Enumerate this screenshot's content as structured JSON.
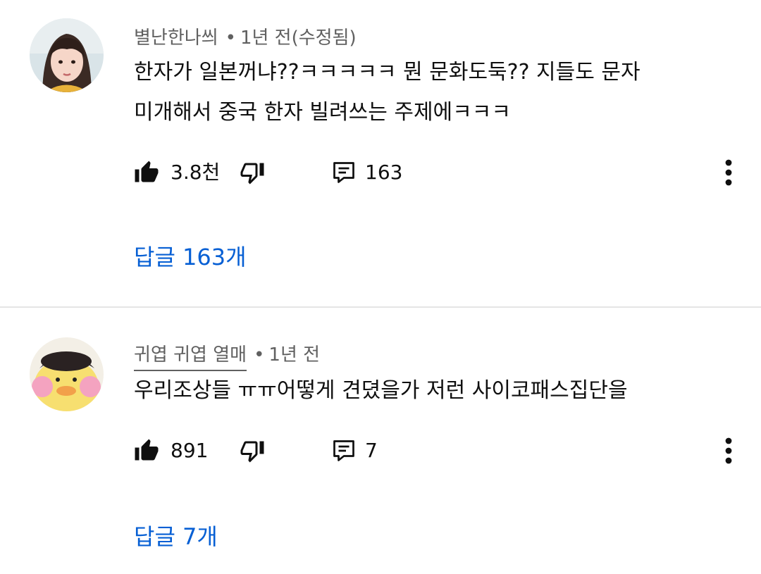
{
  "comments": [
    {
      "author": "별난한나씌",
      "time": "1년 전(수정됨)",
      "text_line1": "한자가 일본꺼냐??ㅋㅋㅋㅋㅋ 뭔 문화도둑?? 지들도 문자",
      "text_line2": "미개해서 중국 한자 빌려쓰는 주제에ㅋㅋㅋ",
      "likes": "3.8천",
      "reply_count": "163",
      "replies_link": "답글 163개",
      "avatar_icon": "profile-photo-girl"
    },
    {
      "author": "귀엽 귀엽 열매",
      "time": "1년 전",
      "text_line1": "우리조상들 ㅠㅠ어떻게 견뎠을가 저런 사이코패스집단을",
      "likes": "891",
      "reply_count": "7",
      "replies_link": "답글 7개",
      "avatar_icon": "yellow-duck-plush"
    }
  ],
  "icons": {
    "like": "thumbs-up-filled-icon",
    "dislike": "thumbs-down-outline-icon",
    "reply": "comment-icon",
    "more": "vertical-ellipsis-icon"
  },
  "colors": {
    "link": "#065fd4",
    "meta": "#606060",
    "divider": "#e5e5e5"
  }
}
